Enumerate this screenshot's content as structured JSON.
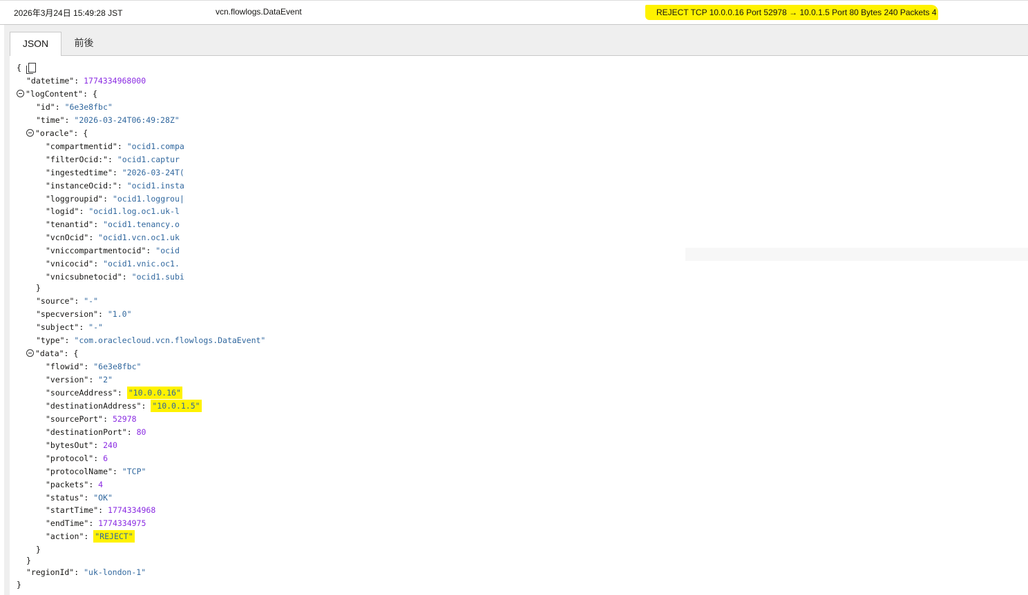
{
  "header": {
    "datetime": "2026年3月24日 15:49:28 JST",
    "type": "vcn.flowlogs.DataEvent",
    "message": "REJECT TCP 10.0.0.16 Port 52978 → 10.0.1.5 Port 80 Bytes 240 Packets 4"
  },
  "tabs": {
    "json": "JSON",
    "diff": "前後"
  },
  "json": {
    "open_brace": "{",
    "close_brace": "}",
    "nested_close": "}",
    "lines": [
      {
        "key": "\"datetime\"",
        "val": "1774334968000",
        "vtype": "n",
        "indent": 1
      },
      {
        "key": "\"logContent\"",
        "val": "{",
        "vtype": "k",
        "indent": 1,
        "toggle": true
      },
      {
        "key": "\"id\"",
        "val": "\"6e3e8fbc\"",
        "vtype": "s",
        "indent": 2
      },
      {
        "key": "\"time\"",
        "val": "\"2026-03-24T06:49:28Z\"",
        "vtype": "s",
        "indent": 2
      },
      {
        "key": "\"oracle\"",
        "val": "{",
        "vtype": "k",
        "indent": 2,
        "toggle": true
      },
      {
        "key": "\"compartmentid\"",
        "val": "\"ocid1.compa",
        "vtype": "s",
        "indent": 3
      },
      {
        "key": "\"filterOcid:\"",
        "val": "\"ocid1.captur",
        "vtype": "s",
        "indent": 3
      },
      {
        "key": "\"ingestedtime\"",
        "val": "\"2026-03-24T(",
        "vtype": "s",
        "indent": 3
      },
      {
        "key": "\"instanceOcid:\"",
        "val": "\"ocid1.insta",
        "vtype": "s",
        "indent": 3
      },
      {
        "key": "\"loggroupid\"",
        "val": "\"ocid1.loggrou|",
        "vtype": "s",
        "indent": 3
      },
      {
        "key": "\"logid\"",
        "val": "\"ocid1.log.oc1.uk-l",
        "vtype": "s",
        "indent": 3
      },
      {
        "key": "\"tenantid\"",
        "val": "\"ocid1.tenancy.o",
        "vtype": "s",
        "indent": 3
      },
      {
        "key": "\"vcnOcid\"",
        "val": "\"ocid1.vcn.oc1.uk",
        "vtype": "s",
        "indent": 3
      },
      {
        "key": "\"vniccompartmentocid\"",
        "val": "\"ocid",
        "vtype": "s",
        "indent": 3
      },
      {
        "key": "\"vnicocid\"",
        "val": "\"ocid1.vnic.oc1.",
        "vtype": "s",
        "indent": 3
      },
      {
        "key": "\"vnicsubnetocid\"",
        "val": "\"ocid1.subi",
        "vtype": "s",
        "indent": 3
      }
    ],
    "lines2": [
      {
        "key": "\"source\"",
        "val": "\"-\"",
        "vtype": "s",
        "indent": 2
      },
      {
        "key": "\"specversion\"",
        "val": "\"1.0\"",
        "vtype": "s",
        "indent": 2
      },
      {
        "key": "\"subject\"",
        "val": "\"-\"",
        "vtype": "s",
        "indent": 2
      },
      {
        "key": "\"type\"",
        "val": "\"com.oraclecloud.vcn.flowlogs.DataEvent\"",
        "vtype": "s",
        "indent": 2
      },
      {
        "key": "\"data\"",
        "val": "{",
        "vtype": "k",
        "indent": 2,
        "toggle": true
      },
      {
        "key": "\"flowid\"",
        "val": "\"6e3e8fbc\"",
        "vtype": "s",
        "indent": 3
      },
      {
        "key": "\"version\"",
        "val": "\"2\"",
        "vtype": "s",
        "indent": 3
      },
      {
        "key": "\"sourceAddress\"",
        "val": "\"10.0.0.16\"",
        "vtype": "s",
        "indent": 3,
        "hl": true
      },
      {
        "key": "\"destinationAddress\"",
        "val": "\"10.0.1.5\"",
        "vtype": "s",
        "indent": 3,
        "hl": true
      },
      {
        "key": "\"sourcePort\"",
        "val": "52978",
        "vtype": "n",
        "indent": 3
      },
      {
        "key": "\"destinationPort\"",
        "val": "80",
        "vtype": "n",
        "indent": 3
      },
      {
        "key": "\"bytesOut\"",
        "val": "240",
        "vtype": "n",
        "indent": 3
      },
      {
        "key": "\"protocol\"",
        "val": "6",
        "vtype": "n",
        "indent": 3
      },
      {
        "key": "\"protocolName\"",
        "val": "\"TCP\"",
        "vtype": "s",
        "indent": 3
      },
      {
        "key": "\"packets\"",
        "val": "4",
        "vtype": "n",
        "indent": 3
      },
      {
        "key": "\"status\"",
        "val": "\"OK\"",
        "vtype": "s",
        "indent": 3
      },
      {
        "key": "\"startTime\"",
        "val": "1774334968",
        "vtype": "n",
        "indent": 3
      },
      {
        "key": "\"endTime\"",
        "val": "1774334975",
        "vtype": "n",
        "indent": 3
      },
      {
        "key": "\"action\"",
        "val": "\"REJECT\"",
        "vtype": "s",
        "indent": 3,
        "hl": true
      }
    ],
    "tail": [
      {
        "key": "\"regionId\"",
        "val": "\"uk-london-1\"",
        "vtype": "s",
        "indent": 1
      }
    ]
  },
  "colors": {
    "highlight": "#fff200",
    "string": "#30679e",
    "number": "#8a2be2"
  }
}
